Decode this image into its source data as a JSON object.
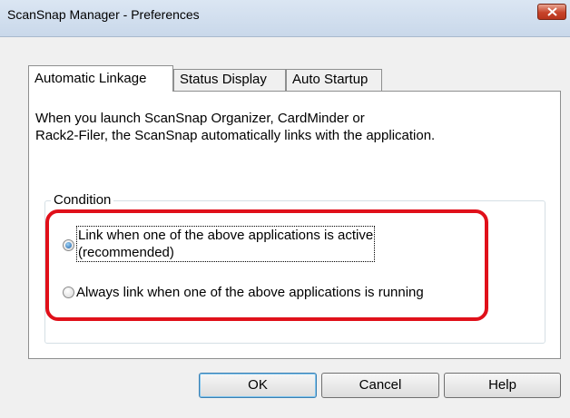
{
  "window": {
    "title": "ScanSnap Manager - Preferences"
  },
  "tabs": [
    {
      "label": "Automatic Linkage",
      "active": true
    },
    {
      "label": "Status Display",
      "active": false
    },
    {
      "label": "Auto Startup",
      "active": false
    }
  ],
  "panel": {
    "description_lines": [
      "When you launch ScanSnap Organizer, CardMinder or",
      "Rack2-Filer, the ScanSnap automatically links with the application."
    ],
    "condition": {
      "legend": "Condition",
      "options": [
        {
          "lines": [
            "Link when one of the above applications is active",
            "(recommended)"
          ],
          "selected": true
        },
        {
          "lines": [
            "Always link when one of the above applications is running"
          ],
          "selected": false
        }
      ]
    }
  },
  "buttons": {
    "ok": "OK",
    "cancel": "Cancel",
    "help": "Help"
  },
  "colors": {
    "highlight": "#e0101a",
    "close_button": "#c7442a"
  },
  "icons": {
    "close": "close-icon"
  }
}
